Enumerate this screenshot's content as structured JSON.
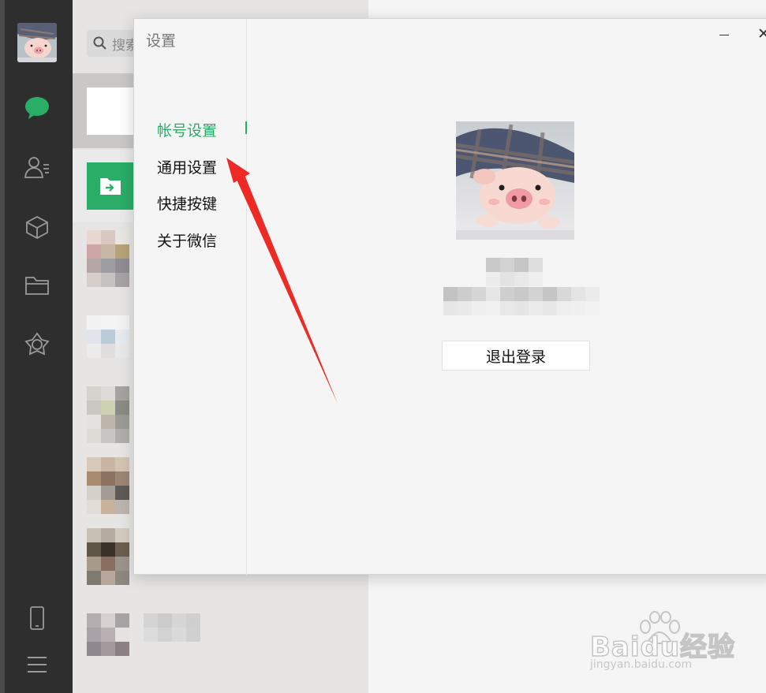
{
  "search": {
    "placeholder": "搜索"
  },
  "dialog": {
    "title": "设置",
    "menu": [
      "帐号设置",
      "通用设置",
      "快捷按键",
      "关于微信"
    ],
    "active_index": 0,
    "logout_label": "退出登录"
  },
  "watermark": {
    "brand": "Baidu经验",
    "site": "jingyan.baidu.com"
  },
  "colors": {
    "accent": "#2aae67",
    "rail": "#2e2e2e",
    "annotation": "#ee2a24"
  },
  "icons": {
    "rail": [
      "chat-icon",
      "contacts-icon",
      "favorites-icon",
      "files-icon",
      "moments-icon",
      "phone-icon",
      "menu-icon"
    ],
    "search": "search-icon",
    "file_transfer": "file-transfer-icon"
  }
}
